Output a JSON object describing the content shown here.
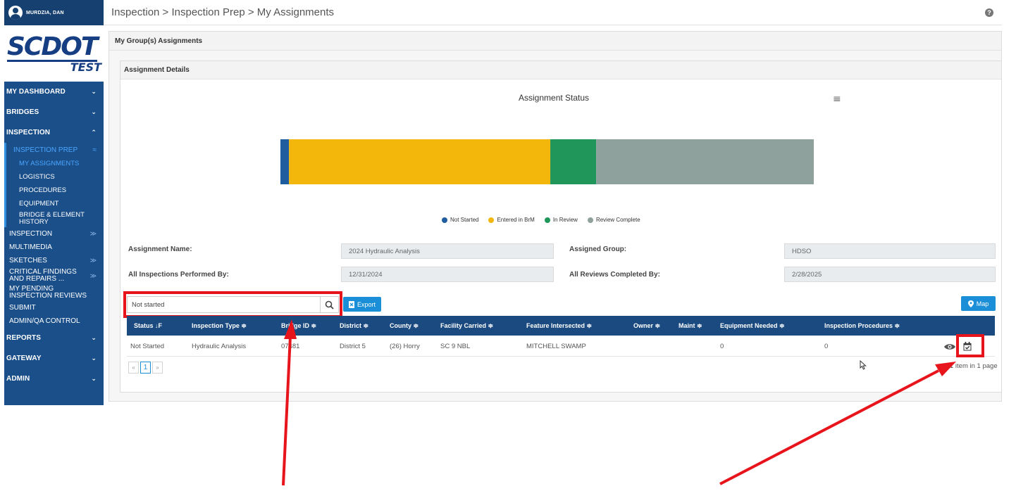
{
  "user": {
    "name": "MURDZIA, DAN"
  },
  "logo": {
    "main": "SCDOT",
    "sub": "TEST"
  },
  "sidebar": {
    "top_items": [
      {
        "label": "MY DASHBOARD",
        "chevron": "⌄"
      },
      {
        "label": "BRIDGES",
        "chevron": "⌄"
      },
      {
        "label": "INSPECTION",
        "chevron": "⌃"
      }
    ],
    "inspection_prep": {
      "label": "INSPECTION PREP",
      "chevron": "≈"
    },
    "prep_items": [
      "MY ASSIGNMENTS",
      "LOGISTICS",
      "PROCEDURES",
      "EQUIPMENT",
      "BRIDGE & ELEMENT HISTORY"
    ],
    "sub_items": [
      {
        "label": "INSPECTION",
        "chevron": "≫"
      },
      {
        "label": "MULTIMEDIA",
        "chevron": ""
      },
      {
        "label": "SKETCHES",
        "chevron": "≫"
      },
      {
        "label": "CRITICAL FINDINGS AND REPAIRS ...",
        "chevron": "≫"
      },
      {
        "label": "MY PENDING INSPECTION REVIEWS",
        "chevron": ""
      },
      {
        "label": "SUBMIT",
        "chevron": ""
      },
      {
        "label": "ADMIN/QA CONTROL",
        "chevron": ""
      }
    ],
    "bottom_items": [
      {
        "label": "REPORTS",
        "chevron": "⌄"
      },
      {
        "label": "GATEWAY",
        "chevron": "⌄"
      },
      {
        "label": "ADMIN",
        "chevron": "⌄"
      }
    ]
  },
  "header": {
    "breadcrumb": "Inspection > Inspection Prep > My Assignments",
    "help": "?"
  },
  "group_panel": {
    "title": "My Group(s) Assignments"
  },
  "details_panel": {
    "title": "Assignment Details"
  },
  "chart_data": {
    "type": "bar",
    "orientation": "horizontal-stacked",
    "title": "Assignment Status",
    "series": [
      {
        "name": "Not Started",
        "value": 1.6,
        "color": "#1f5d9e"
      },
      {
        "name": "Entered in BrM",
        "value": 49,
        "color": "#f2b70a"
      },
      {
        "name": "In Review",
        "value": 8.6,
        "color": "#20965b"
      },
      {
        "name": "Review Complete",
        "value": 40.8,
        "color": "#8fa19d"
      }
    ]
  },
  "form": {
    "assignment_name_label": "Assignment Name:",
    "assignment_name_value": "2024 Hydraulic Analysis",
    "assigned_group_label": "Assigned Group:",
    "assigned_group_value": "HDSO",
    "inspections_by_label": "All Inspections Performed By:",
    "inspections_by_value": "12/31/2024",
    "reviews_by_label": "All Reviews Completed By:",
    "reviews_by_value": "2/28/2025"
  },
  "toolbar": {
    "search_value": "Not started",
    "export_label": "Export",
    "map_label": "Map"
  },
  "table": {
    "columns": [
      "Status ↓F",
      "Inspection Type ≑",
      "Bridge ID ≑",
      "District ≑",
      "County ≑",
      "Facility Carried ≑",
      "Feature Intersected ≑",
      "Owner ≑",
      "Maint ≑",
      "Equipment Needed ≑",
      "Inspection Procedures ≑"
    ],
    "rows": [
      {
        "status": "Not Started",
        "inspection_type": "Hydraulic Analysis",
        "bridge_id": "07481",
        "district": "District 5",
        "county": "(26) Horry",
        "facility": "SC 9 NBL",
        "feature": "MITCHELL SWAMP",
        "owner": "",
        "maint": "",
        "equipment": "0",
        "procedures": "0"
      }
    ]
  },
  "pagination": {
    "prev": "«",
    "current": "1",
    "next": "»",
    "info": "1 item in 1 page"
  },
  "colors": {
    "sidebar": "#1b4f8a",
    "accent": "#1a8fd8",
    "table_header": "#1a4a80",
    "highlight": "#e8141c"
  }
}
